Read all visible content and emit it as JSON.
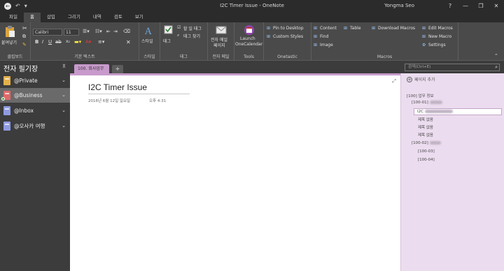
{
  "window": {
    "title": "I2C Timer Issue - OneNote",
    "user": "Yongma Seo",
    "minimize": "—",
    "restore": "❐",
    "close": "✕"
  },
  "quick_access": {
    "back": "←",
    "undo": "↶",
    "more": "▾"
  },
  "ribbon_tabs": [
    "파일",
    "홈",
    "삽입",
    "그리기",
    "내역",
    "검토",
    "보기"
  ],
  "ribbon": {
    "clipboard": {
      "paste": "붙여넣기",
      "label": "클립보드"
    },
    "basic_text": {
      "font": "Calibri",
      "size": "11",
      "label": "기본 텍스트"
    },
    "styles": {
      "button": "스타일",
      "label": "스타일"
    },
    "tags": {
      "button": "태그",
      "todo_tag": "할 일 태그",
      "find_tags": "태그 찾기",
      "label": "태그"
    },
    "email": {
      "button_line1": "전자 메일",
      "button_line2": "페이지",
      "label": "전자 메일"
    },
    "tools": {
      "button_line1": "Launch",
      "button_line2": "OneCalendar",
      "label": "Tools"
    },
    "onetastic": {
      "pin": "Pin to Desktop",
      "custom_styles": "Custom Styles",
      "label": "Onetastic"
    },
    "macros": {
      "content": "Content",
      "find": "Find",
      "image": "Image",
      "table": "Table",
      "download": "Download Macros",
      "edit": "Edit Macros",
      "new": "New Macro",
      "settings": "Settings",
      "label": "Macros"
    }
  },
  "notebooks_header": {
    "title": "전자 필기장",
    "pin": "⊼"
  },
  "notebooks": [
    {
      "name": "@Private",
      "color": "#e3b04b"
    },
    {
      "name": "@Business",
      "color": "#e06a6a"
    },
    {
      "name": "@Inbox",
      "color": "#8f9be0"
    },
    {
      "name": "@오사카 여행",
      "color": "#8f9be0"
    }
  ],
  "section_tabs": {
    "active": "100. 회사업무",
    "add": "+"
  },
  "search": {
    "placeholder": "검색(Ctrl+E)",
    "icon": "⌕"
  },
  "page": {
    "title": "I2C Timer Issue",
    "date": "2016년 6월 12일 일요일",
    "time": "오후 4:31",
    "expand": "⤢"
  },
  "page_list": {
    "add_page": "페이지 추가",
    "items": [
      {
        "text": "[100] 업무 정보",
        "level": 0,
        "blur": 0
      },
      {
        "text": "[100-01]",
        "level": 1,
        "blur": 18
      },
      {
        "text": "I2C",
        "level": 2,
        "blur": 40,
        "selected": true
      },
      {
        "text": "제목 없음",
        "level": 2,
        "blur": 0
      },
      {
        "text": "제목 없음",
        "level": 2,
        "blur": 0
      },
      {
        "text": "제목 없음",
        "level": 2,
        "blur": 0
      },
      {
        "text": "[100-02]",
        "level": 1,
        "blur": 16
      },
      {
        "text": "[100-03]",
        "level": 2,
        "blur": 0
      },
      {
        "text": "[100-04]",
        "level": 2,
        "blur": 0
      }
    ]
  }
}
